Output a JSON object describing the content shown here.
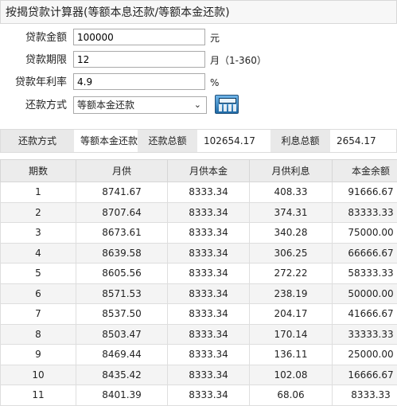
{
  "title": "按揭贷款计算器(等额本息还款/等额本金还款)",
  "form": {
    "amount": {
      "label": "贷款金额",
      "value": "100000",
      "unit": "元"
    },
    "term": {
      "label": "贷款期限",
      "value": "12",
      "unit": "月（1-360）"
    },
    "rate": {
      "label": "贷款年利率",
      "value": "4.9",
      "unit": "%"
    },
    "method": {
      "label": "还款方式",
      "selected": "等额本金还款",
      "arrow_icon": "chevron-down-icon"
    },
    "calculate_icon": "calculator-icon"
  },
  "summary": {
    "method_label": "还款方式",
    "method_value": "等额本金还款",
    "total_label": "还款总额",
    "total_value": "102654.17",
    "interest_label": "利息总额",
    "interest_value": "2654.17"
  },
  "table": {
    "headers": [
      "期数",
      "月供",
      "月供本金",
      "月供利息",
      "本金余额"
    ],
    "rows": [
      [
        "1",
        "8741.67",
        "8333.34",
        "408.33",
        "91666.67"
      ],
      [
        "2",
        "8707.64",
        "8333.34",
        "374.31",
        "83333.33"
      ],
      [
        "3",
        "8673.61",
        "8333.34",
        "340.28",
        "75000.00"
      ],
      [
        "4",
        "8639.58",
        "8333.34",
        "306.25",
        "66666.67"
      ],
      [
        "5",
        "8605.56",
        "8333.34",
        "272.22",
        "58333.33"
      ],
      [
        "6",
        "8571.53",
        "8333.34",
        "238.19",
        "50000.00"
      ],
      [
        "7",
        "8537.50",
        "8333.34",
        "204.17",
        "41666.67"
      ],
      [
        "8",
        "8503.47",
        "8333.34",
        "170.14",
        "33333.33"
      ],
      [
        "9",
        "8469.44",
        "8333.34",
        "136.11",
        "25000.00"
      ],
      [
        "10",
        "8435.42",
        "8333.34",
        "102.08",
        "16666.67"
      ],
      [
        "11",
        "8401.39",
        "8333.34",
        "68.06",
        "8333.33"
      ]
    ]
  }
}
